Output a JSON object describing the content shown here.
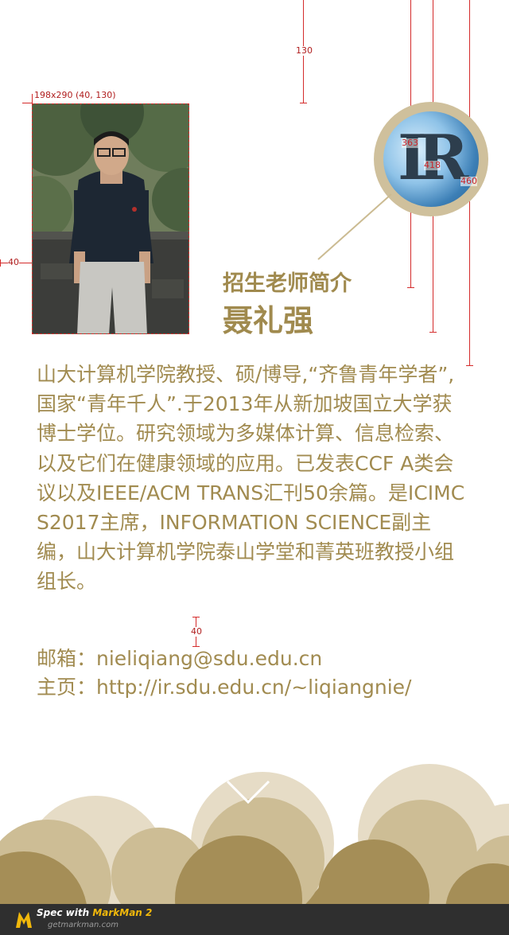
{
  "measurements": {
    "photo_spec": "198x290 (40, 130)",
    "top_gap": "130",
    "left_gap": "40",
    "dist_a": "363",
    "dist_b": "418",
    "dist_c": "460",
    "bio_gap": "40"
  },
  "profile": {
    "section_title": "招生老师简介",
    "name": "聂礼强",
    "bio": "山大计算机学院教授、硕/博导,“齐鲁青年学者”,国家“青年千人”.于2013年从新加坡国立大学获博士学位。研究领域为多媒体计算、信息检索、以及它们在健康领域的应用。已发表CCF A类会议以及IEEE/ACM TRANS汇刊50余篇。是ICIMCS2017主席，INFORMATION SCIENCE副主编，山大计算机学院泰山学堂和菁英班教授小组组长。",
    "email_line": "邮箱：nieliqiang@sdu.edu.cn",
    "homepage_line": "主页：http://ir.sdu.edu.cn/~liqiangnie/"
  },
  "logo": {
    "letters": "IR",
    "icon": "ir-lab-logo"
  },
  "footer": {
    "spec_prefix": "Spec with ",
    "spec_brand": "MarkMan 2",
    "site": "getmarkman.com"
  },
  "colors": {
    "accent_gold": "#a18b50",
    "cloud_light": "#e6dcc6",
    "cloud_mid": "#cdbd95",
    "cloud_dark": "#a58e57",
    "measure_red": "#d42b2b",
    "footer_bg": "#2f2f2f"
  }
}
